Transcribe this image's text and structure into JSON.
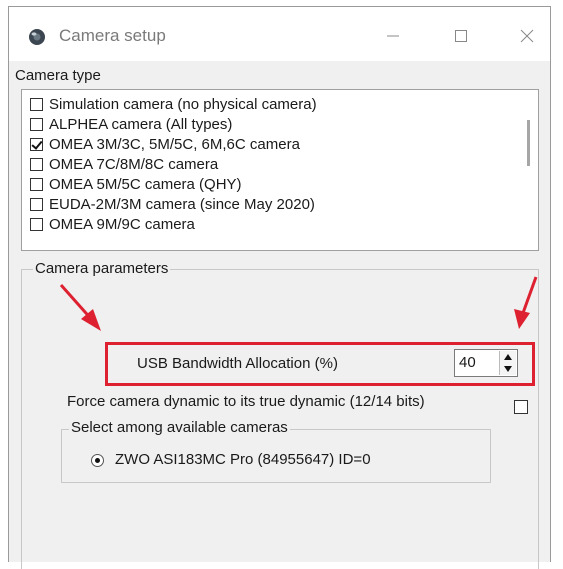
{
  "window": {
    "title": "Camera setup",
    "controls": {
      "minimize": "minimize-icon",
      "maximize": "maximize-icon",
      "close": "close-icon"
    }
  },
  "camera_type": {
    "label": "Camera type",
    "items": [
      {
        "label": "Simulation camera (no physical camera)",
        "checked": false
      },
      {
        "label": "ALPHEA camera (All types)",
        "checked": false
      },
      {
        "label": "OMEA 3M/3C, 5M/5C, 6M,6C camera",
        "checked": true
      },
      {
        "label": "OMEA 7C/8M/8C camera",
        "checked": false
      },
      {
        "label": "OMEA 5M/5C camera (QHY)",
        "checked": false
      },
      {
        "label": "EUDA-2M/3M camera (since May 2020)",
        "checked": false
      },
      {
        "label": "OMEA 9M/9C camera",
        "checked": false
      }
    ]
  },
  "camera_parameters": {
    "label": "Camera parameters",
    "usb_bandwidth_label": "USB Bandwidth Allocation (%)",
    "usb_bandwidth_value": "40",
    "force_dynamic_label": "Force camera dynamic to its true dynamic (12/14 bits)",
    "force_dynamic_checked": false,
    "select_cameras": {
      "label": "Select among available cameras",
      "option_label": "ZWO ASI183MC Pro  (84955647)  ID=0",
      "selected": true
    }
  },
  "colors": {
    "annotation_red": "#dd2130",
    "window_bg": "#f0f0f0"
  }
}
